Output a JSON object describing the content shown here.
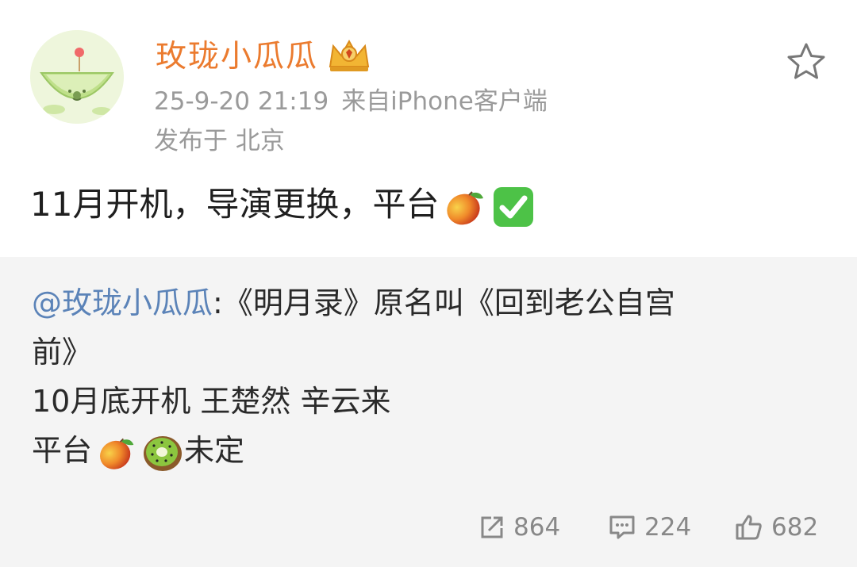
{
  "post": {
    "author": "玫珑小瓜瓜",
    "timestamp": "25-9-20 21:19",
    "source": "来自iPhone客户端",
    "location": "发布于 北京",
    "text": "11月开机，导演更换，平台",
    "emojis": [
      "mango-emoji",
      "check-mark-emoji"
    ]
  },
  "repost": {
    "mention": "@玫珑小瓜瓜",
    "line1_text": ":《明月录》原名叫《回到老公自宫",
    "line2": "前》",
    "line3": "10月底开机 王楚然 辛云来",
    "line4_prefix": "平台",
    "line4_suffix": "未定",
    "line4_emojis": [
      "mango-emoji",
      "kiwi-emoji"
    ]
  },
  "stats": {
    "reposts": "864",
    "comments": "224",
    "likes": "682"
  },
  "icons": {
    "vip": "crown-badge-icon",
    "favorite": "star-icon",
    "repost": "share-icon",
    "comment": "comment-icon",
    "like": "thumbs-up-icon"
  },
  "colors": {
    "username": "#eb7b2f",
    "mention": "#5b83b8",
    "meta": "#9a9a9a",
    "repost_background": "#f4f4f4"
  }
}
